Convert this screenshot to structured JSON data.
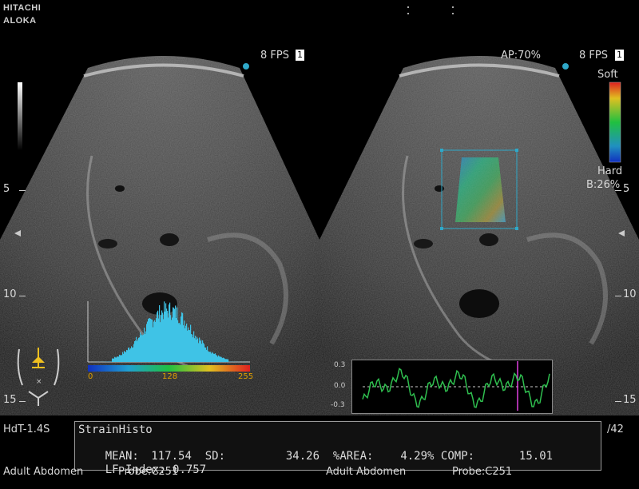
{
  "brand": {
    "line1": "HITACHI",
    "line2": "ALOKA"
  },
  "header": {
    "left_fps": "8 FPS",
    "left_frame": "1",
    "right_ap": "AP:70%",
    "right_fps": "8 FPS",
    "right_frame": "1"
  },
  "elastography_scale": {
    "top_label": "Soft",
    "bottom_label": "Hard",
    "b_gain": "B:26%"
  },
  "depth_scale": {
    "labels": [
      "5",
      "10",
      "15"
    ]
  },
  "histogram": {
    "axis_labels": [
      "0",
      "128",
      "255"
    ],
    "fill_color": "#3fc3e6"
  },
  "strain_graph": {
    "y_labels": [
      "0.3",
      "0.0",
      "-0.3"
    ],
    "line_color": "#2fbf4f",
    "marker_color": "#e040e0"
  },
  "left_labels": {
    "probe_mode": "HdT-1.4S"
  },
  "right_labels": {
    "frame_total": "/42"
  },
  "stats_panel": {
    "title": "StrainHisto",
    "mean_label": "MEAN:",
    "mean_value": "117.54",
    "sd_label": "SD:",
    "sd_value": "34.26",
    "area_label": "%AREA:",
    "area_value": "4.29%",
    "comp_label": "COMP:",
    "comp_value": "15.01",
    "lf_label": "LF Index:",
    "lf_value": "0.757"
  },
  "footer": {
    "left_preset": "Adult Abdomen",
    "left_probe": "Probe:C251",
    "right_preset": "Adult Abdomen",
    "right_probe": "Probe:C251"
  },
  "colors": {
    "accent_cyan": "#2fa8c8",
    "panel_border": "#9a9a9a"
  }
}
